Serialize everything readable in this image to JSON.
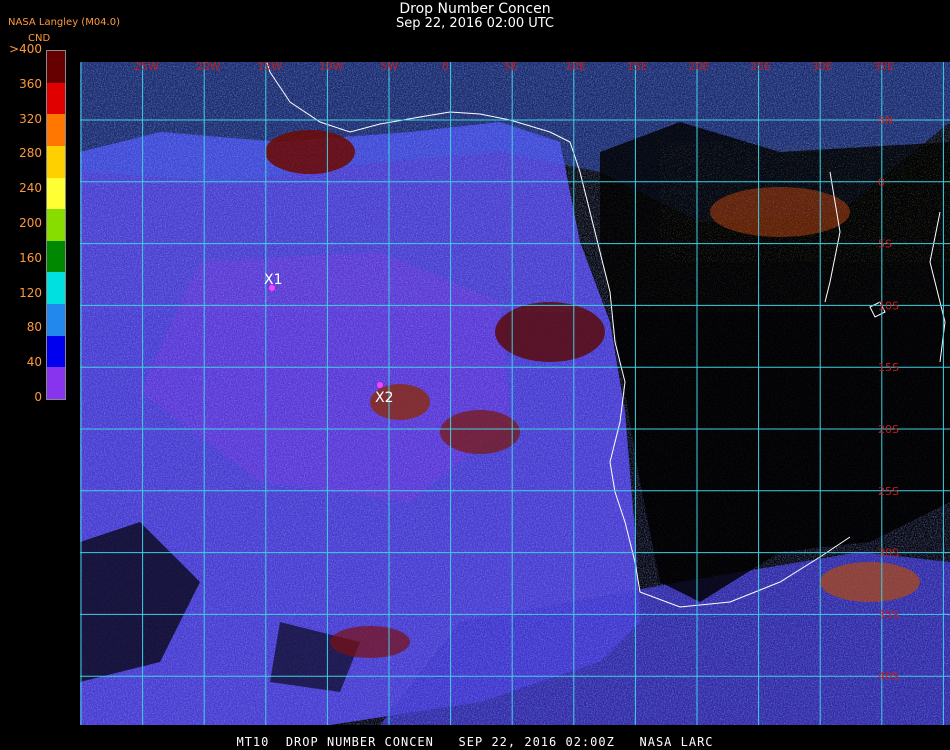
{
  "header": {
    "title": "Drop Number Concen",
    "datetime": "Sep 22, 2016 02:00 UTC",
    "agency": "NASA Langley (M04.0)",
    "unit": "CND"
  },
  "colorbar": {
    "labels": [
      ">400",
      "360",
      "320",
      "280",
      "240",
      "200",
      "160",
      "120",
      "80",
      "40",
      "0"
    ],
    "colors": [
      "#660000",
      "#e00000",
      "#ff7700",
      "#ffd000",
      "#ffff33",
      "#88dd00",
      "#008800",
      "#00e0e0",
      "#2288ee",
      "#0000ee",
      "#8833ee"
    ]
  },
  "grid": {
    "lon_labels": [
      "25W",
      "20W",
      "15W",
      "10W",
      "5W",
      "0",
      "5E",
      "10E",
      "15E",
      "20E",
      "25E",
      "30E",
      "35E"
    ],
    "lat_labels": [
      "5N",
      "0",
      "5S",
      "10S",
      "15S",
      "20S",
      "25S",
      "30S",
      "35S",
      "40S"
    ]
  },
  "markers": [
    {
      "label": "X1"
    },
    {
      "label": "X2"
    }
  ],
  "footer": "MT10  DROP NUMBER CONCEN   SEP 22, 2016 02:00Z   NASA LARC"
}
